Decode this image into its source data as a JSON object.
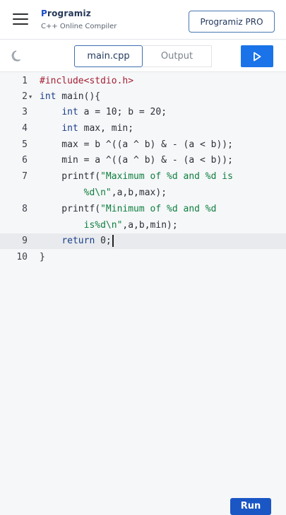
{
  "header": {
    "brand_prefix": "P",
    "brand_rest": "rogramiz",
    "subtitle": "C++ Online Compiler",
    "pro_button": "Programiz PRO"
  },
  "toolbar": {
    "tabs": [
      {
        "label": "main.cpp",
        "active": true
      },
      {
        "label": "Output",
        "active": false
      }
    ]
  },
  "editor": {
    "line_numbers": [
      "1",
      "2",
      "3",
      "4",
      "5",
      "6",
      "7",
      "",
      "8",
      "",
      "9",
      "10"
    ],
    "lines": [
      "#include<stdio.h>",
      "int main(){",
      "    int a = 10; b = 20;",
      "    int max, min;",
      "    max = b ^((a ^ b) & - (a < b));",
      "    min = a ^((a ^ b) & - (a < b));",
      "    printf(\"Maximum of %d and %d is",
      "        %d\\n\",a,b,max);",
      "    printf(\"Minimum of %d and %d",
      "        is%d\\n\",a,b,min);",
      "    return 0;",
      "}"
    ],
    "active_line": 9
  },
  "bottom": {
    "run_label": "Run"
  },
  "colors": {
    "accent": "#1a73e8",
    "keyword": "#1b3f8b",
    "string": "#0e7f3f",
    "include": "#a32134"
  }
}
